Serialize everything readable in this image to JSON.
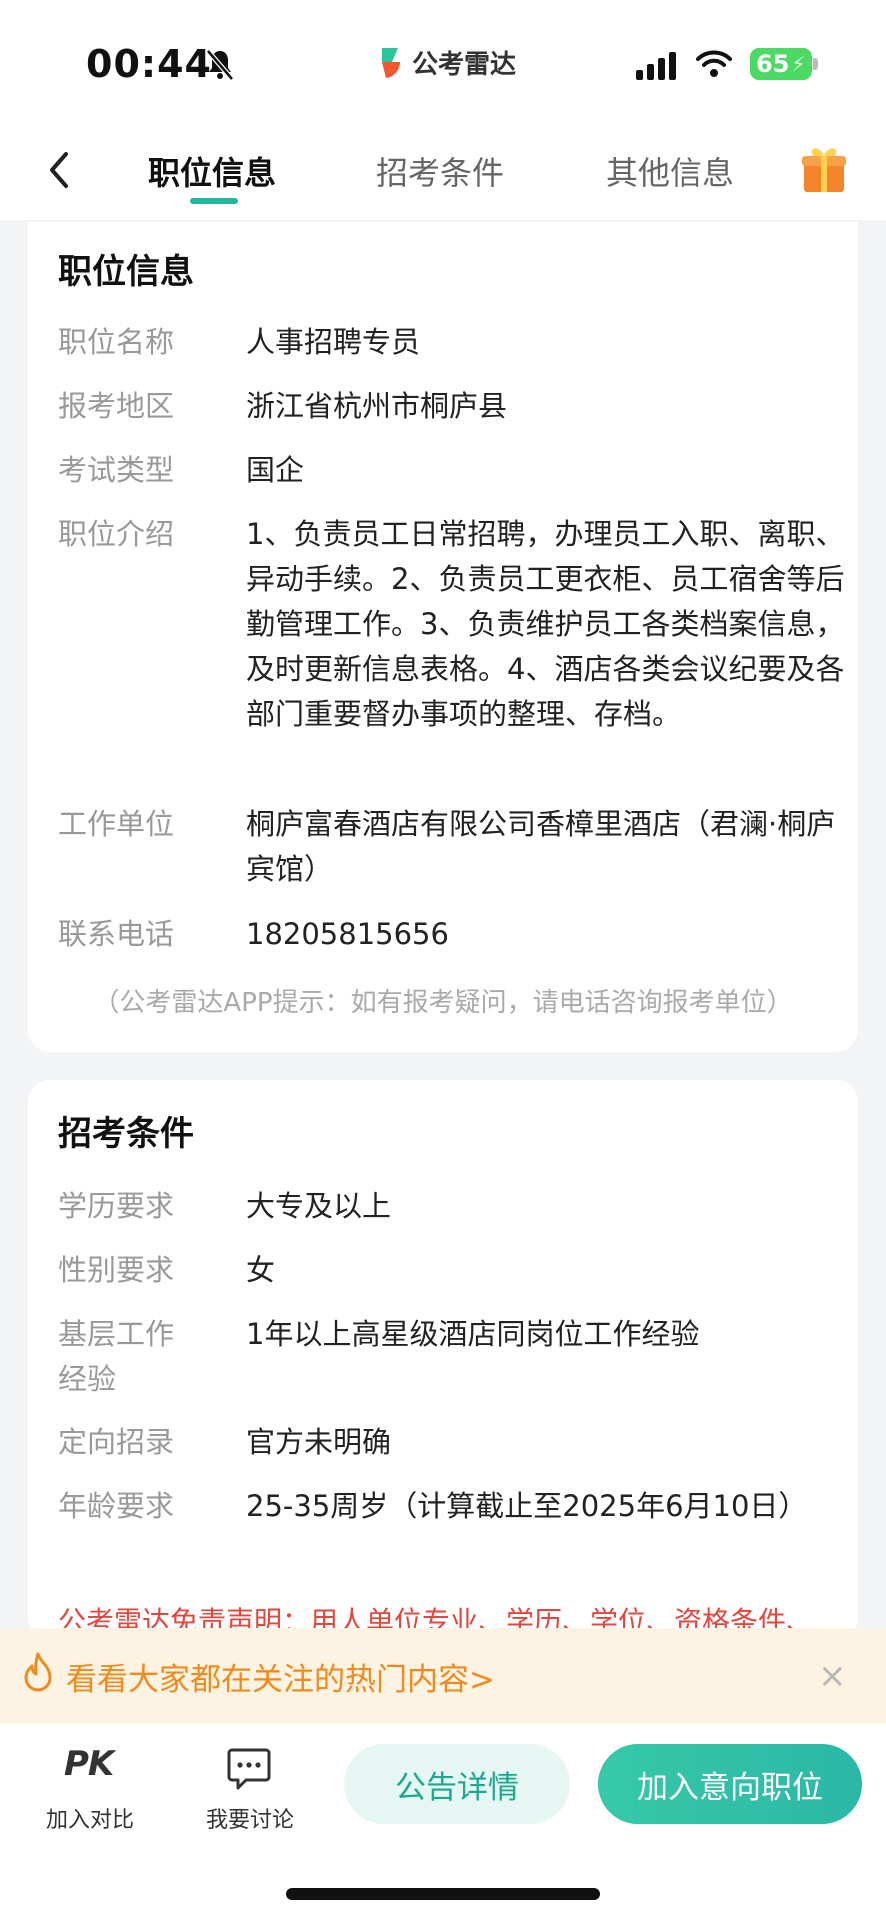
{
  "status_bar": {
    "time": "00:44",
    "app_name": "公考雷达",
    "battery": "65"
  },
  "tabs": [
    {
      "label": "职位信息",
      "active": true
    },
    {
      "label": "招考条件",
      "active": false
    },
    {
      "label": "其他信息",
      "active": false
    }
  ],
  "position_info": {
    "title": "职位信息",
    "rows": [
      {
        "label": "职位名称",
        "value": "人事招聘专员"
      },
      {
        "label": "报考地区",
        "value": "浙江省杭州市桐庐县"
      },
      {
        "label": "考试类型",
        "value": "国企"
      },
      {
        "label": "职位介绍",
        "value": "1、负责员工日常招聘，办理员工入职、离职、异动手续。2、负责员工更衣柜、员工宿舍等后勤管理工作。3、负责维护员工各类档案信息，及时更新信息表格。4、酒店各类会议纪要及各部门重要督办事项的整理、存档。"
      },
      {
        "label": "工作单位",
        "value": "桐庐富春酒店有限公司香樟里酒店（君澜·桐庐宾馆）"
      },
      {
        "label": "联系电话",
        "value": "18205815656"
      }
    ],
    "hint": "（公考雷达APP提示：如有报考疑问，请电话咨询报考单位）"
  },
  "requirements": {
    "title": "招考条件",
    "rows": [
      {
        "label": "学历要求",
        "value": "大专及以上"
      },
      {
        "label": "性别要求",
        "value": "女"
      },
      {
        "label": "基层工作经验",
        "value": "1年以上高星级酒店同岗位工作经验"
      },
      {
        "label": "定向招录",
        "value": "官方未明确"
      },
      {
        "label": "年龄要求",
        "value": "25-35周岁（计算截止至2025年6月10日）"
      }
    ],
    "disclaimer": "公考雷达免责声明：用人单位专业、学历、学位、资格条件、"
  },
  "banner": {
    "text": "看看大家都在关注的热门内容>",
    "close": "×"
  },
  "bottom_bar": {
    "compare_icon": "PK",
    "compare_label": "加入对比",
    "discuss_label": "我要讨论",
    "detail_button": "公告详情",
    "join_button": "加入意向职位"
  },
  "colors": {
    "accent": "#22b7a1",
    "warning": "#e4463c",
    "banner_text": "#f08a1c"
  }
}
